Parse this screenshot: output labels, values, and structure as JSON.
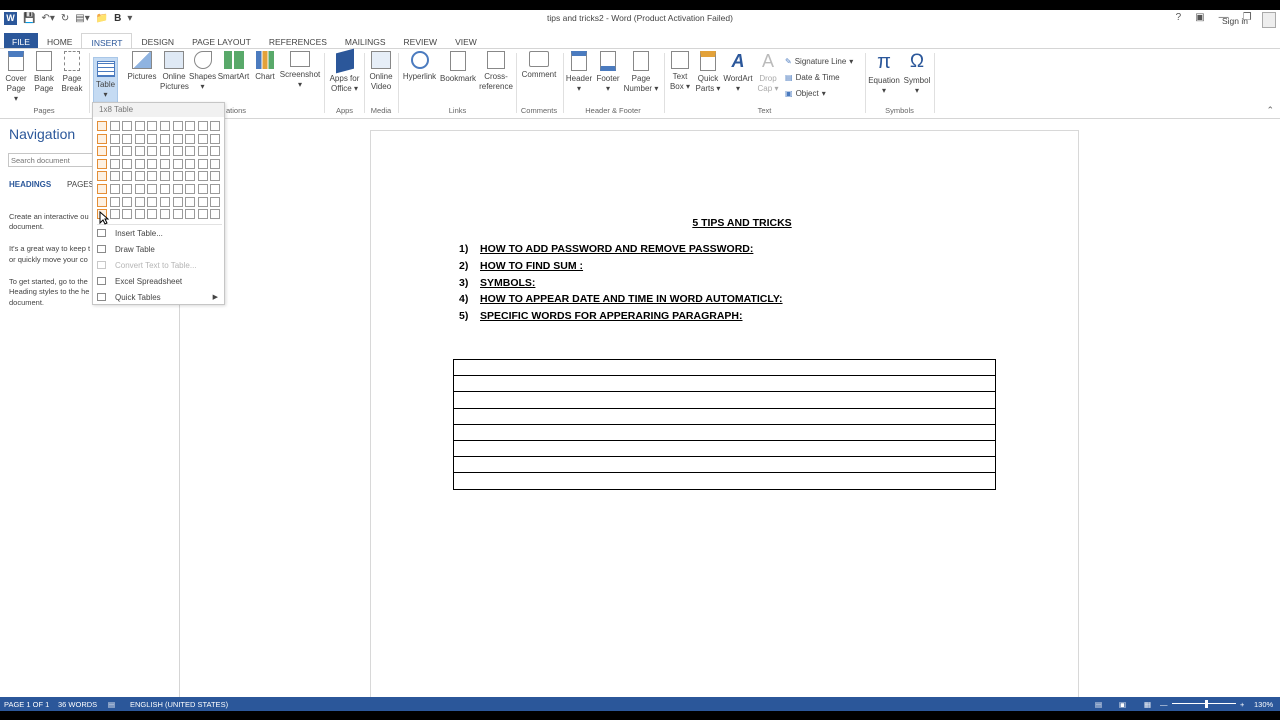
{
  "window": {
    "title": "tips and tricks2 - Word (Product Activation Failed)",
    "sign_in": "Sign in",
    "help": "?"
  },
  "qat": {
    "bold": "B"
  },
  "tabs": [
    "FILE",
    "HOME",
    "INSERT",
    "DESIGN",
    "PAGE LAYOUT",
    "REFERENCES",
    "MAILINGS",
    "REVIEW",
    "VIEW"
  ],
  "ribbon": {
    "pages": {
      "cover": [
        "Cover",
        "Page"
      ],
      "blank": [
        "Blank",
        "Page"
      ],
      "break": [
        "Page",
        "Break"
      ],
      "label": "Pages"
    },
    "table": {
      "label": "Table"
    },
    "illustrations": {
      "pictures": "Pictures",
      "online": [
        "Online",
        "Pictures"
      ],
      "shapes": "Shapes",
      "smartart": "SmartArt",
      "chart": "Chart",
      "screenshot": "Screenshot",
      "label": "ations"
    },
    "apps": {
      "btn": [
        "Apps for",
        "Office"
      ],
      "label": "Apps"
    },
    "media": {
      "btn": [
        "Online",
        "Video"
      ],
      "label": "Media"
    },
    "links": {
      "hyperlink": "Hyperlink",
      "bookmark": "Bookmark",
      "cross": [
        "Cross-",
        "reference"
      ],
      "label": "Links"
    },
    "comments": {
      "btn": "Comment",
      "label": "Comments"
    },
    "hf": {
      "header": "Header",
      "footer": "Footer",
      "pagenum": [
        "Page",
        "Number"
      ],
      "label": "Header & Footer"
    },
    "text": {
      "textbox": [
        "Text",
        "Box"
      ],
      "quick": [
        "Quick",
        "Parts"
      ],
      "wordart": "WordArt",
      "dropcap": [
        "Drop",
        "Cap"
      ],
      "signature": "Signature Line",
      "datetime": "Date & Time",
      "object": "Object",
      "label": "Text"
    },
    "symbols": {
      "equation": "Equation",
      "symbol": "Symbol",
      "label": "Symbols",
      "pi": "π",
      "omega": "Ω"
    }
  },
  "nav": {
    "title": "Navigation",
    "search_placeholder": "Search document",
    "tabs": [
      "HEADINGS",
      "PAGES"
    ],
    "text": [
      "Create an interactive ou",
      "document.",
      "It's a great way to keep t",
      "or quickly move your co",
      "To get started, go to the",
      "Heading styles to the he",
      "document."
    ]
  },
  "dropdown": {
    "header": "1x8 Table",
    "items": [
      "Insert Table...",
      "Draw Table",
      "Convert Text to Table...",
      "Excel Spreadsheet",
      "Quick Tables"
    ]
  },
  "document": {
    "heading": "5 TIPS AND TRICKS",
    "list": [
      {
        "num": "1)",
        "text": "HOW TO ADD PASSWORD AND REMOVE PASSWORD:"
      },
      {
        "num": "2)",
        "text": "HOW TO FIND SUM :"
      },
      {
        "num": "3)",
        "text": "SYMBOLS:"
      },
      {
        "num": "4)",
        "text": "HOW TO APPEAR DATE AND TIME IN WORD AUTOMATICLY:"
      },
      {
        "num": "5)",
        "text": "SPECIFIC WORDS FOR APPERARING PARAGRAPH:"
      }
    ],
    "table_rows": 8
  },
  "status": {
    "page": "PAGE 1 OF 1",
    "words": "36 WORDS",
    "language": "ENGLISH (UNITED STATES)",
    "zoom": "130%"
  },
  "colors": {
    "accent": "#2b579a",
    "highlight": "#e48e36"
  }
}
